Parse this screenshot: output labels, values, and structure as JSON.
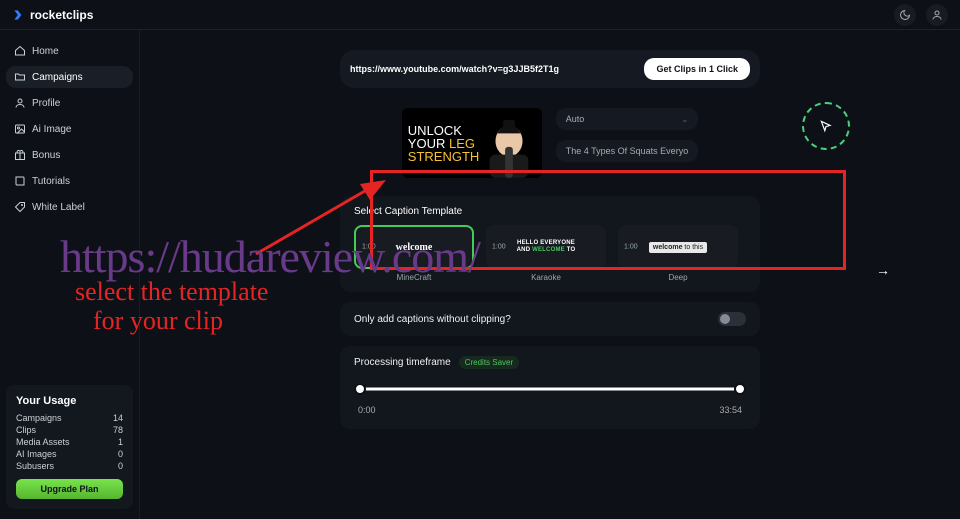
{
  "brand": "rocketclips",
  "top": {
    "theme_icon": "theme-icon",
    "user_icon": "user-icon"
  },
  "sidebar": {
    "items": [
      {
        "icon": "home",
        "label": "Home",
        "active": false
      },
      {
        "icon": "folder",
        "label": "Campaigns",
        "active": true
      },
      {
        "icon": "user",
        "label": "Profile",
        "active": false
      },
      {
        "icon": "image",
        "label": "Ai Image",
        "active": false
      },
      {
        "icon": "gift",
        "label": "Bonus",
        "active": false
      },
      {
        "icon": "book",
        "label": "Tutorials",
        "active": false
      },
      {
        "icon": "tag",
        "label": "White Label",
        "active": false
      }
    ]
  },
  "usage": {
    "title": "Your Usage",
    "rows": [
      {
        "k": "Campaigns",
        "v": "14"
      },
      {
        "k": "Clips",
        "v": "78"
      },
      {
        "k": "Media Assets",
        "v": "1"
      },
      {
        "k": "AI Images",
        "v": "0"
      },
      {
        "k": "Subusers",
        "v": "0"
      }
    ],
    "button": "Upgrade Plan"
  },
  "url_bar": {
    "url": "https://www.youtube.com/watch?v=g3JJB5f2T1g",
    "button": "Get Clips in 1 Click"
  },
  "thumb": {
    "line1": "UNLOCK",
    "line2a": "YOUR ",
    "line2b": "LEG",
    "line3": "STRENGTH"
  },
  "options": {
    "mode": "Auto",
    "video_title": "The 4 Types Of Squats Everyo"
  },
  "templates": {
    "heading": "Select Caption Template",
    "list": [
      {
        "ts": "1:00",
        "name": "MineCraft",
        "text": "welcome"
      },
      {
        "ts": "1:00",
        "name": "Karaoke",
        "line1": "HELLO EVERYONE",
        "line2a": "AND ",
        "line2w": "WELCOME",
        "line2b": " TO"
      },
      {
        "ts": "1:00",
        "name": "Deep",
        "chip_before": "welcome",
        "chip_after": " to this"
      }
    ]
  },
  "toggle": {
    "label": "Only add captions without clipping?"
  },
  "timeframe": {
    "title": "Processing timeframe",
    "badge": "Credits Saver",
    "start": "0:00",
    "end": "33:54"
  },
  "annotations": {
    "watermark": "https://hudareview.com/",
    "callout_l1": "select the template",
    "callout_l2": "for your clip"
  }
}
